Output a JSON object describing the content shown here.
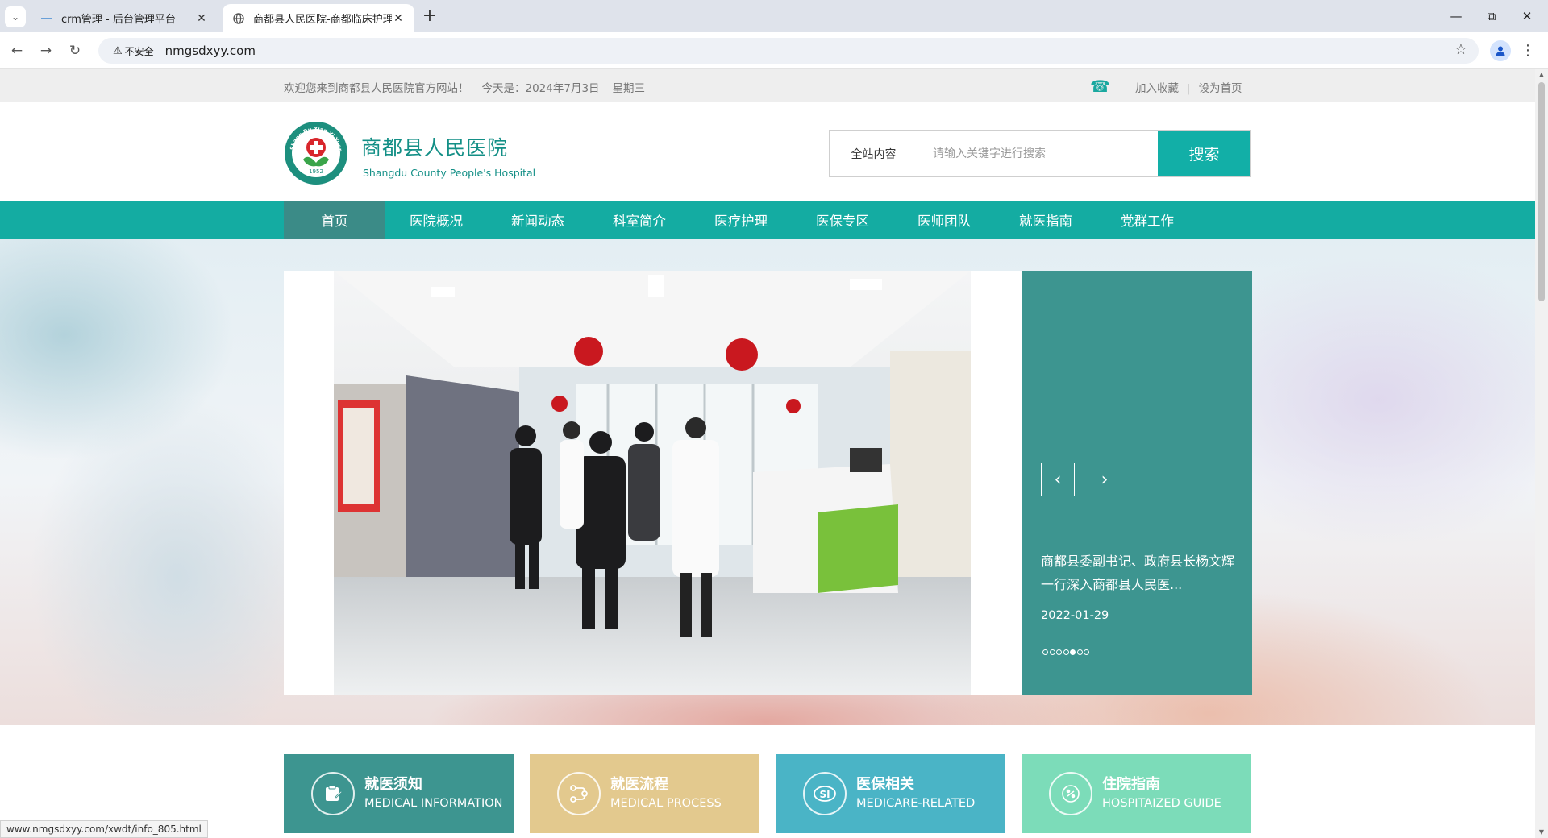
{
  "browser": {
    "tabs": [
      {
        "title": "crm管理 - 后台管理平台",
        "active": false
      },
      {
        "title": "商都县人民医院-商都临床护理",
        "active": true
      }
    ],
    "new_tab": "+",
    "insecure_label": "不安全",
    "url": "nmgsdxyy.com",
    "status_url": "www.nmgsdxyy.com/xwdt/info_805.html"
  },
  "topbar": {
    "welcome": "欢迎您来到商都县人民医院官方网站！",
    "date": "今天是：2024年7月3日",
    "weekday": "星期三",
    "bookmark": "加入收藏",
    "set_home": "设为首页"
  },
  "header": {
    "name_cn": "商都县人民医院",
    "name_en": "Shangdu County People's Hospital",
    "logo_year": "1952",
    "logo_ring_text": "Shang Du Xian Yi Yuan",
    "search_scope": "全站内容",
    "search_placeholder": "请输入关键字进行搜索",
    "search_button": "搜索"
  },
  "nav": {
    "items": [
      "首页",
      "医院概况",
      "新闻动态",
      "科室简介",
      "医疗护理",
      "医保专区",
      "医师团队",
      "就医指南",
      "党群工作"
    ],
    "active_index": 0
  },
  "slider": {
    "title": "商都县委副书记、政府县长杨文辉一行深入商都县人民医...",
    "date": "2022-01-29",
    "dot_count": 7,
    "active_dot": 4
  },
  "cards": [
    {
      "title": "就医须知",
      "subtitle": "MEDICAL INFORMATION",
      "color": "#3d9590",
      "icon": "notice-icon"
    },
    {
      "title": "就医流程",
      "subtitle": "MEDICAL PROCESS",
      "color": "#e3c98e",
      "icon": "process-icon"
    },
    {
      "title": "医保相关",
      "subtitle": "MEDICARE-RELATED",
      "color": "#4ab4c6",
      "icon": "medicare-icon"
    },
    {
      "title": "住院指南",
      "subtitle": "HOSPITAIZED GUIDE",
      "color": "#7cdcb9",
      "icon": "hospitalized-icon"
    }
  ],
  "colors": {
    "brand": "#14aca2",
    "nav_active": "#3b8b87",
    "panel": "#3d9590"
  }
}
